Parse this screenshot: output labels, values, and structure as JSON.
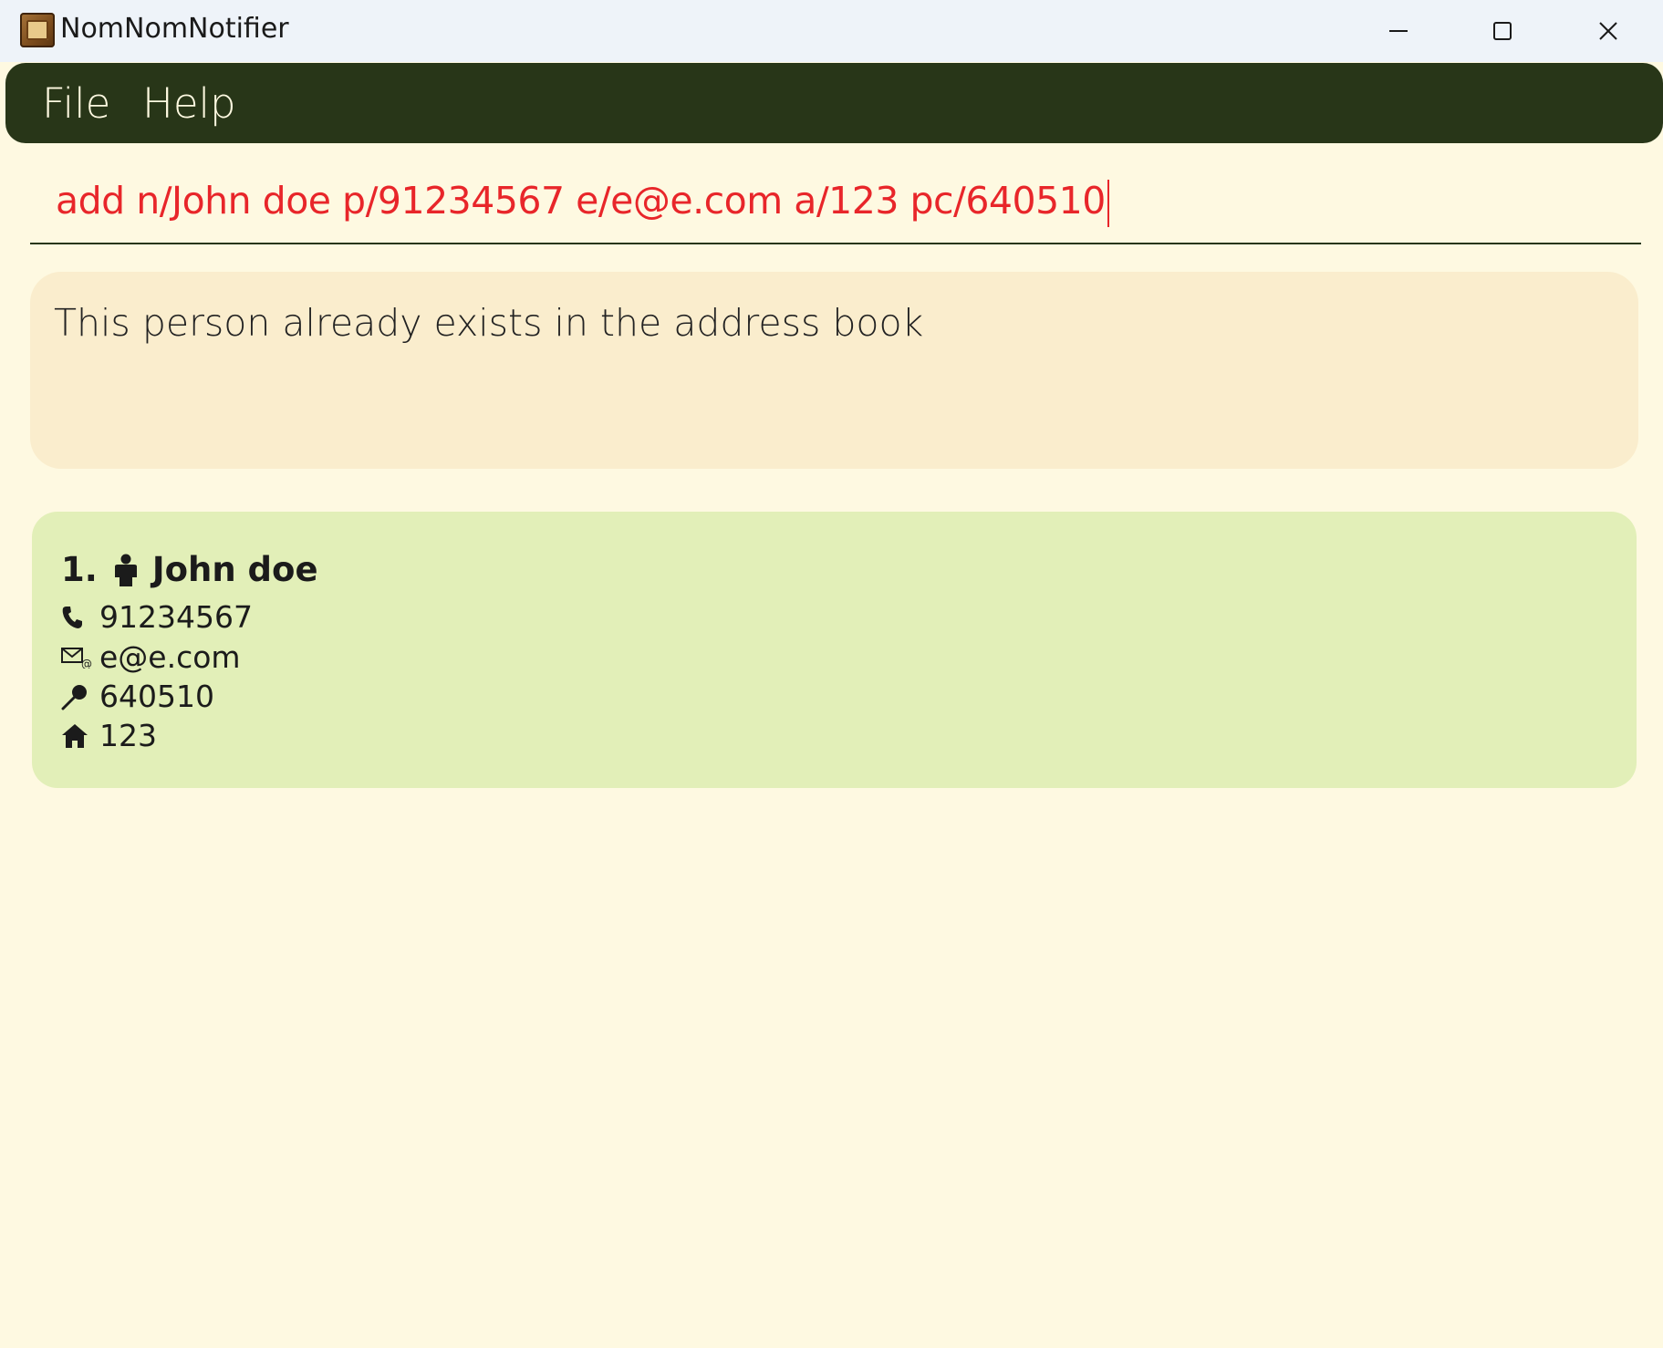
{
  "window": {
    "title": "NomNomNotifier"
  },
  "menu": {
    "file": "File",
    "help": "Help"
  },
  "command": {
    "value": "add n/John doe p/91234567 e/e@e.com a/123 pc/640510"
  },
  "result": {
    "message": "This person already exists in the address book"
  },
  "persons": [
    {
      "index": "1.",
      "name": "John doe",
      "phone": "91234567",
      "email": "e@e.com",
      "postal_code": "640510",
      "address": "123"
    }
  ],
  "colors": {
    "background": "#fef9e1",
    "menubar": "#283618",
    "command_text": "#e8262a",
    "result_bg": "#faedcd",
    "card_bg": "#e2efb8"
  },
  "icons": {
    "app": "nomnom-app-icon",
    "person": "person-icon",
    "phone": "phone-icon",
    "email": "email-icon",
    "postal": "pin-icon",
    "address": "home-icon"
  }
}
